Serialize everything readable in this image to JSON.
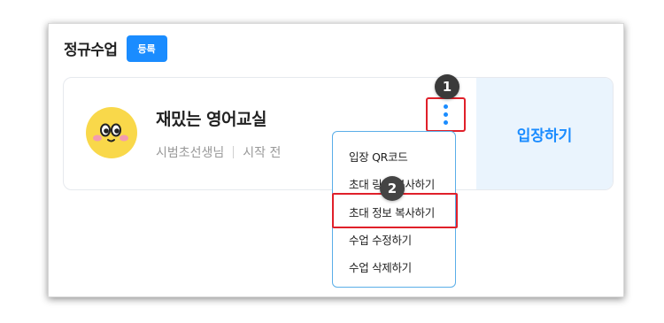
{
  "section": {
    "title": "정규수업",
    "register_label": "등록"
  },
  "card": {
    "title": "재밌는 영어교실",
    "teacher": "시범초선생님",
    "status": "시작 전",
    "enter_label": "입장하기"
  },
  "menu": {
    "items": [
      {
        "label": "입장 QR코드"
      },
      {
        "label": "초대 링크 복사하기"
      },
      {
        "label": "초대 정보 복사하기"
      },
      {
        "label": "수업 수정하기"
      },
      {
        "label": "수업 삭제하기"
      }
    ]
  },
  "steps": [
    "1",
    "2"
  ],
  "colors": {
    "accent": "#1a8cff",
    "highlight": "#e0202a",
    "panel": "#eaf4fd"
  },
  "icons": {
    "more": "more-vertical-icon",
    "avatar": "smiley-avatar"
  }
}
